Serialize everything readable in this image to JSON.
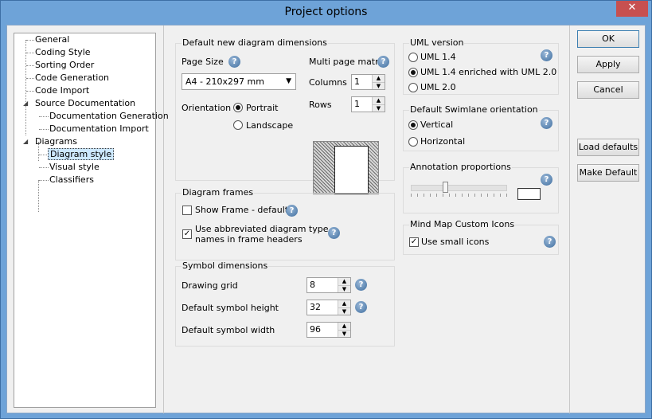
{
  "window": {
    "title": "Project options",
    "close_glyph": "✕"
  },
  "tree": {
    "items": [
      {
        "label": "General",
        "depth": 0
      },
      {
        "label": "Coding Style",
        "depth": 0
      },
      {
        "label": "Sorting Order",
        "depth": 0
      },
      {
        "label": "Code Generation",
        "depth": 0
      },
      {
        "label": "Code Import",
        "depth": 0
      },
      {
        "label": "Source Documentation",
        "depth": 0,
        "expanded": true
      },
      {
        "label": "Documentation Generation",
        "depth": 1
      },
      {
        "label": "Documentation Import",
        "depth": 1
      },
      {
        "label": "Diagrams",
        "depth": 0,
        "expanded": true
      },
      {
        "label": "Diagram style",
        "depth": 1,
        "selected": true
      },
      {
        "label": "Visual style",
        "depth": 1
      },
      {
        "label": "Classifiers",
        "depth": 1
      }
    ]
  },
  "dimensions": {
    "title": "Default new diagram dimensions",
    "page_size_label": "Page Size",
    "page_size_value": "A4 - 210x297 mm",
    "multi_page_label": "Multi page matrix",
    "columns_label": "Columns",
    "columns_value": "1",
    "rows_label": "Rows",
    "rows_value": "1",
    "orientation_label": "Orientation",
    "portrait_label": "Portrait",
    "landscape_label": "Landscape",
    "orientation_selected": "Portrait"
  },
  "frames": {
    "title": "Diagram frames",
    "show_frame_label": "Show Frame - default",
    "show_frame_checked": false,
    "abbrev_label_line1": "Use abbreviated diagram type",
    "abbrev_label_line2": "names in frame headers",
    "abbrev_checked": true
  },
  "symbols": {
    "title": "Symbol dimensions",
    "grid_label": "Drawing grid",
    "grid_value": "8",
    "height_label": "Default symbol height",
    "height_value": "32",
    "width_label": "Default symbol width",
    "width_value": "96"
  },
  "uml": {
    "title": "UML version",
    "opt1": "UML 1.4",
    "opt2": "UML 1.4 enriched with UML 2.0",
    "opt3": "UML 2.0",
    "selected": "UML 1.4 enriched with UML 2.0"
  },
  "swimlane": {
    "title": "Default Swimlane orientation",
    "vertical": "Vertical",
    "horizontal": "Horizontal",
    "selected": "Vertical"
  },
  "annotation": {
    "title": "Annotation proportions",
    "slider_level_fraction": 0.33
  },
  "mindmap": {
    "title": "Mind Map Custom Icons",
    "small_icons_label": "Use small icons",
    "small_icons_checked": true
  },
  "buttons": {
    "ok": "OK",
    "apply": "Apply",
    "cancel": "Cancel",
    "load_defaults": "Load defaults",
    "make_default": "Make Default"
  },
  "icons": {
    "help": "question-mark-icon",
    "help_glyph": "?",
    "check_glyph": "✓",
    "dropdown_glyph": "▼",
    "up_glyph": "▲",
    "down_glyph": "▼"
  },
  "colors": {
    "titlebar": "#6ea3d8",
    "selection": "#cde8ff",
    "help_icon": "#3f6e9f"
  }
}
